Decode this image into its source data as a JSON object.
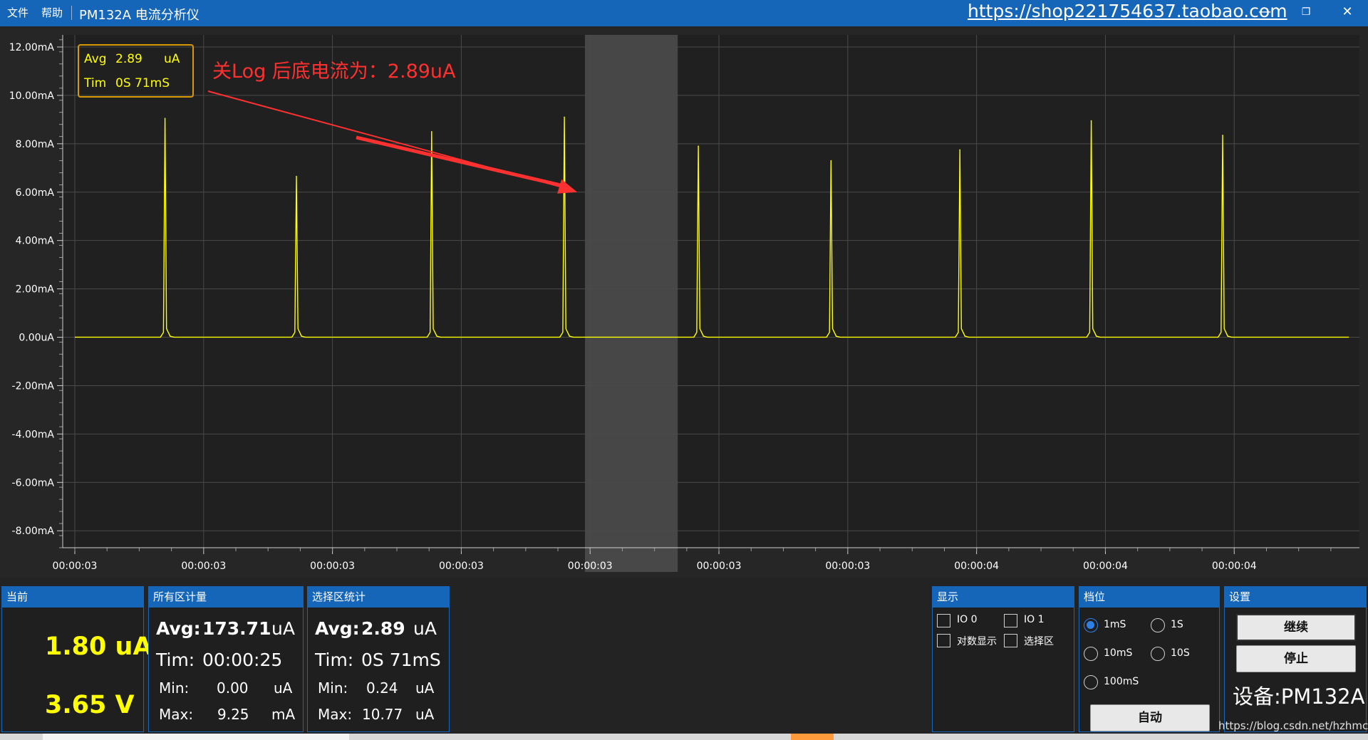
{
  "titlebar": {
    "menu_file": "文件",
    "menu_help": "帮助",
    "title": "PM132A 电流分析仪",
    "shop_link": "https://shop221754637.taobao.com",
    "btn_minimize": "—",
    "btn_restore": "❐",
    "btn_close": "✕"
  },
  "chart_data": {
    "type": "line",
    "title": "",
    "xlabel": "",
    "ylabel": "",
    "y_ticks": [
      "12.00mA",
      "10.00mA",
      "8.00mA",
      "6.00mA",
      "4.00mA",
      "2.00mA",
      "0.00uA",
      "-2.00mA",
      "-4.00mA",
      "-6.00mA",
      "-8.00mA"
    ],
    "y_tick_values": [
      12,
      10,
      8,
      6,
      4,
      2,
      0,
      -2,
      -4,
      -6,
      -8
    ],
    "ylim": [
      -8.7,
      12.5
    ],
    "x_ticks": [
      "00:00:03",
      "00:00:03",
      "00:00:03",
      "00:00:03",
      "00:00:03",
      "00:00:03",
      "00:00:03",
      "00:00:04",
      "00:00:04",
      "00:00:04"
    ],
    "x_tick_values": [
      0,
      1,
      2,
      3,
      4,
      5,
      6,
      7,
      8,
      9
    ],
    "xlim": [
      0,
      9.9
    ],
    "grid": true,
    "series": [
      {
        "color": "#ffff00",
        "baseline_mA": 0.003,
        "peaks": [
          {
            "x": 0.7,
            "y": 9.05
          },
          {
            "x": 1.72,
            "y": 6.65
          },
          {
            "x": 2.77,
            "y": 8.5
          },
          {
            "x": 3.8,
            "y": 9.1
          },
          {
            "x": 4.84,
            "y": 7.9
          },
          {
            "x": 5.87,
            "y": 7.3
          },
          {
            "x": 6.87,
            "y": 7.75
          },
          {
            "x": 7.89,
            "y": 8.95
          },
          {
            "x": 8.91,
            "y": 8.35
          }
        ]
      }
    ],
    "selection": {
      "x_start": 3.96,
      "x_end": 4.68
    },
    "tooltip": {
      "avg_label": "Avg",
      "avg_value": "2.89",
      "avg_unit": "uA",
      "tim_label": "Tim",
      "tim_value": "0S 71mS"
    },
    "annotation": {
      "text": "关Log 后底电流为：2.89uA",
      "color": "#ff3030",
      "arrow_to": {
        "x": 3.9,
        "y": 6.0
      }
    }
  },
  "panel_current": {
    "header": "当前",
    "current_value": "1.80 uA",
    "voltage_value": "3.65 V"
  },
  "panel_all": {
    "header": "所有区计量",
    "avg_label": "Avg:",
    "avg_value": "173.71",
    "avg_unit": "uA",
    "tim_label": "Tim:",
    "tim_value": "00:00:25",
    "min_label": "Min:",
    "min_value": "0.00",
    "min_unit": "uA",
    "max_label": "Max:",
    "max_value": "9.25",
    "max_unit": "mA"
  },
  "panel_selection": {
    "header": "选择区统计",
    "avg_label": "Avg:",
    "avg_value": "2.89",
    "avg_unit": "uA",
    "tim_label": "Tim:",
    "tim_value": "0S 71mS",
    "min_label": "Min:",
    "min_value": "0.24",
    "min_unit": "uA",
    "max_label": "Max:",
    "max_value": "10.77",
    "max_unit": "uA"
  },
  "panel_display": {
    "header": "显示",
    "io0_label": "IO 0",
    "io1_label": "IO 1",
    "log_label": "对数显示",
    "select_label": "选择区"
  },
  "panel_range": {
    "header": "档位",
    "opt_1ms": "1mS",
    "opt_1s": "1S",
    "opt_10ms": "10mS",
    "opt_10s": "10S",
    "opt_100ms": "100mS",
    "auto_button": "自动",
    "selected": "1mS"
  },
  "panel_settings": {
    "header": "设置",
    "continue_button": "继续",
    "stop_button": "停止",
    "device_label": "设备:PM132A"
  },
  "watermark": "https://blog.csdn.net/hzhmcu"
}
